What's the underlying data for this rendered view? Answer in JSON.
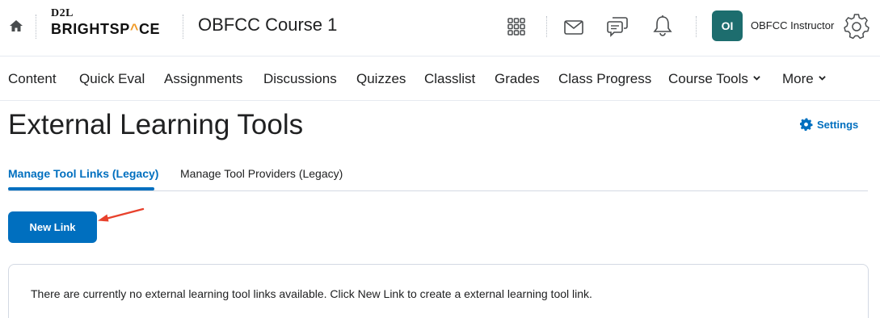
{
  "header": {
    "logo_top": "D2L",
    "logo_bottom_a": "BRIGHTSP",
    "logo_bottom_hat": "^",
    "logo_bottom_b": "CE",
    "course_title": "OBFCC Course 1",
    "user_initials": "OI",
    "user_name": "OBFCC Instructor",
    "icons": [
      "home-icon",
      "waffle-icon",
      "mail-icon",
      "chat-icon",
      "bell-icon",
      "gear-icon"
    ]
  },
  "nav": {
    "items": [
      "Content",
      "Quick Eval",
      "Assignments",
      "Discussions",
      "Quizzes",
      "Classlist",
      "Grades",
      "Class Progress",
      "Course Tools",
      "More"
    ]
  },
  "page": {
    "title": "External Learning Tools",
    "settings_label": "Settings",
    "tabs": [
      "Manage Tool Links (Legacy)",
      "Manage Tool Providers (Legacy)"
    ],
    "new_link_label": "New Link",
    "empty_message": "There are currently no external learning tool links available. Click New Link to create a external learning tool link."
  },
  "colors": {
    "primary": "#006fbf",
    "avatar": "#1d6d6e",
    "logo_accent": "#f09a26",
    "annotation_arrow": "#e8412c"
  }
}
